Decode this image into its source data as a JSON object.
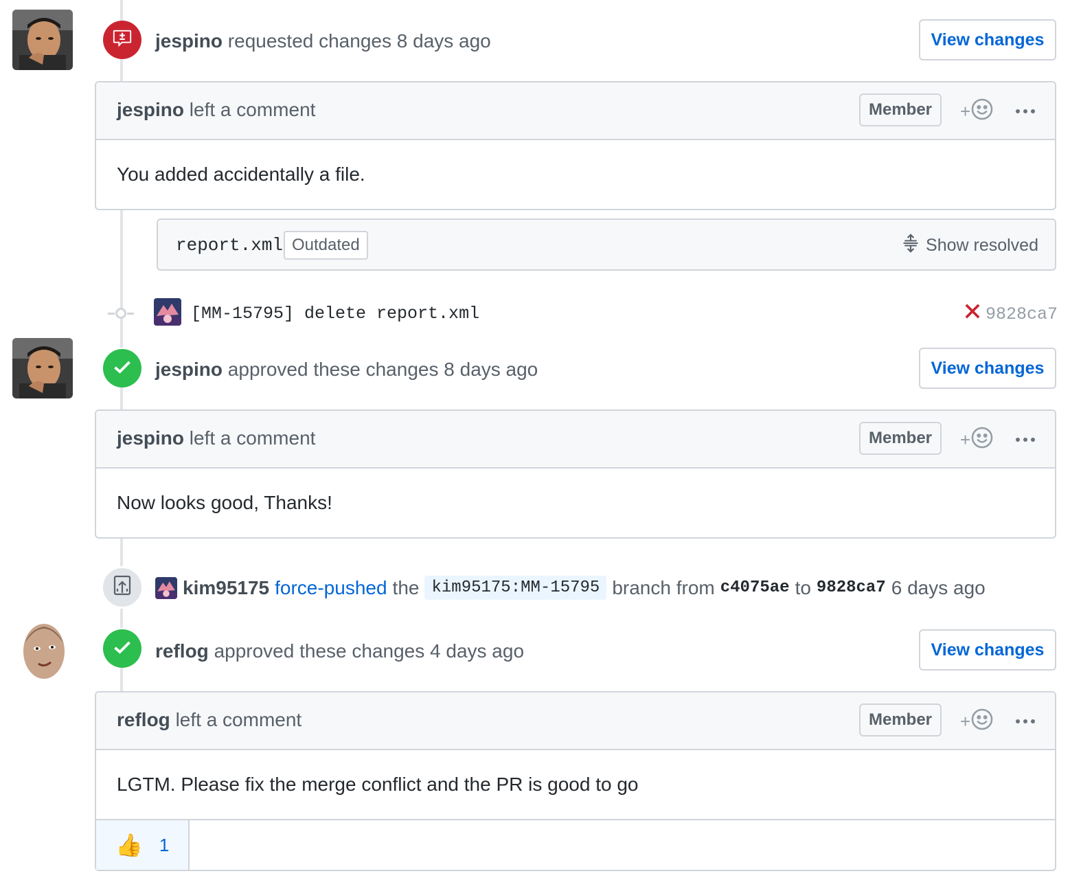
{
  "events": [
    {
      "author": "jespino",
      "action": "requested changes",
      "time": "8 days ago",
      "button": "View changes",
      "comment": {
        "author": "jespino",
        "action": "left a comment",
        "role": "Member",
        "body": "You added accidentally a file."
      },
      "file": {
        "name": "report.xml",
        "status": "Outdated",
        "show_resolved": "Show resolved"
      }
    },
    {
      "author": "jespino",
      "action": "approved these changes",
      "time": "8 days ago",
      "button": "View changes",
      "comment": {
        "author": "jespino",
        "action": "left a comment",
        "role": "Member",
        "body": "Now looks good, Thanks!"
      }
    },
    {
      "author": "reflog",
      "action": "approved these changes",
      "time": "4 days ago",
      "button": "View changes",
      "comment": {
        "author": "reflog",
        "action": "left a comment",
        "role": "Member",
        "body": "LGTM. Please fix the merge conflict and the PR is good to go",
        "reaction": {
          "emoji": "👍",
          "count": "1"
        }
      }
    }
  ],
  "commit": {
    "message": "[MM-15795] delete report.xml",
    "sha": "9828ca7",
    "status": "failed"
  },
  "force_push": {
    "author": "kim95175",
    "action": "force-pushed",
    "the": "the",
    "branch": "kim95175:MM-15795",
    "branch_from": "branch from",
    "from_sha": "c4075ae",
    "to": "to",
    "to_sha": "9828ca7",
    "time": "6 days ago"
  },
  "icons": {
    "requested_changes": "file-diff-icon",
    "approved": "check-icon",
    "force_push": "repo-push-icon",
    "commit_failed": "x-icon",
    "add_reaction": "smiley-icon",
    "more": "kebab-horizontal-icon",
    "resolved": "unfold-icon"
  },
  "colors": {
    "link": "#0366d6",
    "danger": "#cb2431",
    "success": "#2cbe4e",
    "border": "#d1d5da",
    "header_bg": "#f6f8fa"
  }
}
